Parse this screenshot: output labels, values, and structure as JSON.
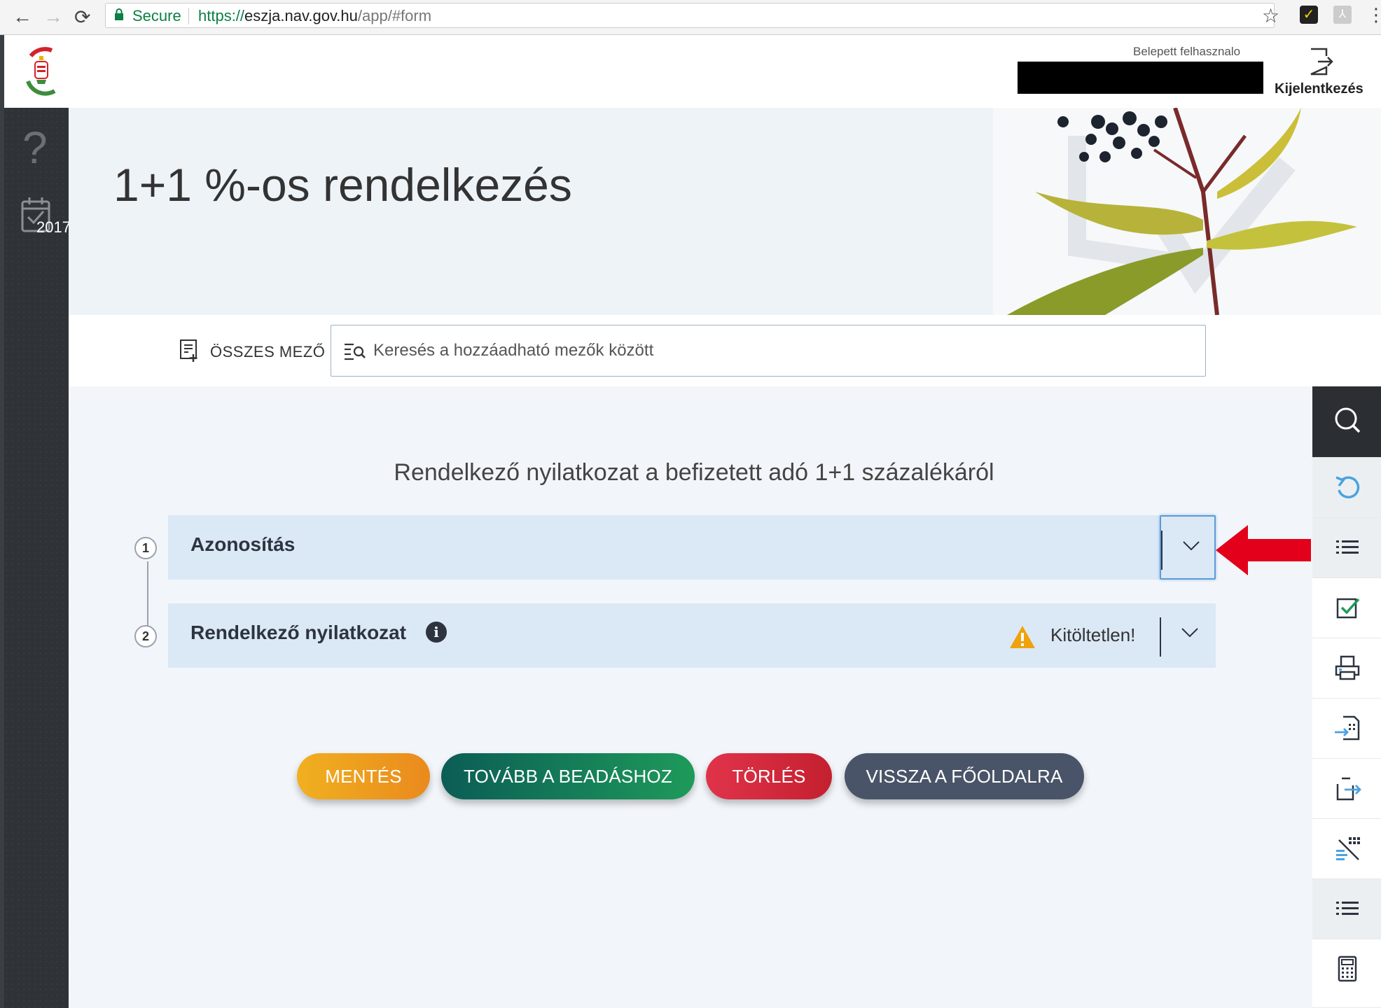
{
  "browser": {
    "secure_label": "Secure",
    "url_scheme": "https://",
    "url_host": "eszja.nav.gov.hu",
    "url_path": "/app/#form"
  },
  "header": {
    "user_label": "Belepett felhasznalo",
    "logout_label": "Kijelentkezés"
  },
  "sidebar": {
    "help_glyph": "?",
    "year": "2017"
  },
  "page": {
    "title": "1+1 %-os rendelkezés"
  },
  "search": {
    "all_fields_label": "ÖSSZES MEZŐ",
    "placeholder": "Keresés a hozzáadható mezők között"
  },
  "form": {
    "heading": "Rendelkező nyilatkozat a befizetett adó 1+1 százalékáról",
    "steps": [
      {
        "number": "1",
        "title": "Azonosítás"
      },
      {
        "number": "2",
        "title": "Rendelkező nyilatkozat",
        "status": "Kitöltetlen!"
      }
    ]
  },
  "actions": {
    "save": "MENTÉS",
    "next": "TOVÁBB A BEADÁSHOZ",
    "delete": "TÖRLÉS",
    "back": "VISSZA A FŐOLDALRA"
  },
  "toolbar_icons": [
    "search-icon",
    "undo-icon",
    "list-icon",
    "check-icon",
    "print-icon",
    "import-icon",
    "export-icon",
    "field-settings-icon",
    "list-icon",
    "calculator-icon"
  ],
  "colors": {
    "accent_blue": "#5b9bd5",
    "save": "#ea8a1d",
    "next": "#1e9a5a",
    "delete": "#c4202f",
    "back": "#4a5468",
    "warning": "#f0a20c",
    "arrow": "#e3001b"
  }
}
